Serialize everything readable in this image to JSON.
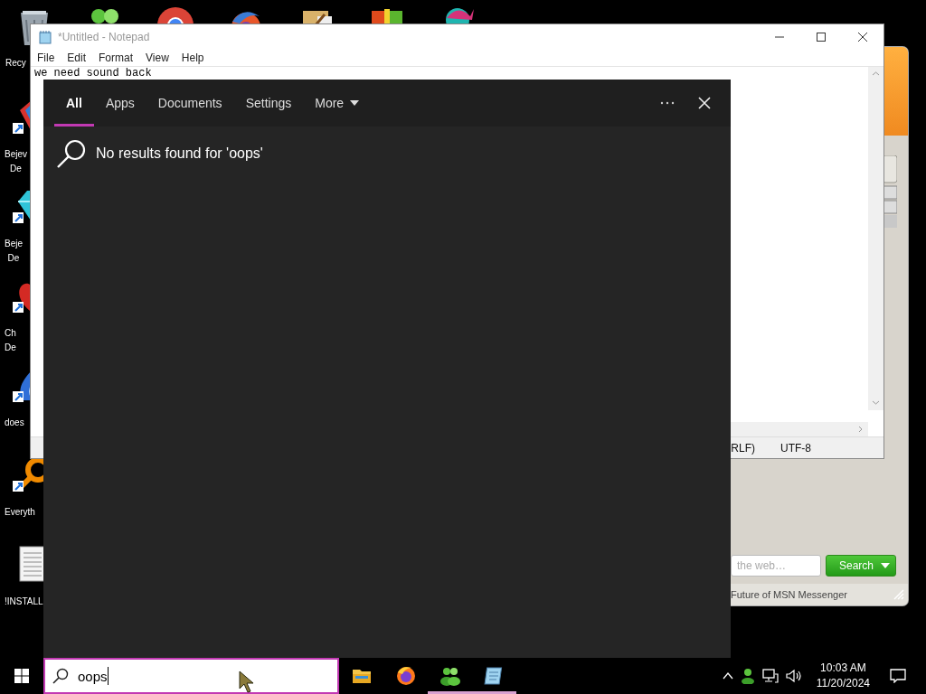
{
  "desktop": {
    "top_icons": [
      {
        "kind": "recycle",
        "label": "Recy"
      },
      {
        "kind": "people"
      },
      {
        "kind": "ring"
      },
      {
        "kind": "swirl"
      },
      {
        "kind": "paint"
      },
      {
        "kind": "shield"
      },
      {
        "kind": "figure"
      }
    ],
    "side_icons": [
      {
        "kind": "gem",
        "label_lines": [
          "Bejev",
          "De"
        ]
      },
      {
        "kind": "diamond",
        "label_lines": [
          "Beje",
          "De"
        ]
      },
      {
        "kind": "heart",
        "label_lines": [
          "Ch",
          "De"
        ]
      },
      {
        "kind": "flame",
        "label_lines": [
          "does"
        ]
      },
      {
        "kind": "magnifier",
        "label_lines": [
          "Everyth"
        ]
      },
      {
        "kind": "document",
        "label_lines": [
          "!INSTALL"
        ]
      }
    ]
  },
  "notepad": {
    "title": "*Untitled - Notepad",
    "menu": [
      "File",
      "Edit",
      "Format",
      "View",
      "Help"
    ],
    "text": "we need sound back",
    "status": [
      "RLF)",
      "UTF-8"
    ]
  },
  "messenger": {
    "search_placeholder": "the web…",
    "search_button": "Search",
    "footer": "Future of MSN Messenger"
  },
  "search_panel": {
    "tabs": [
      {
        "label": "All",
        "selected": true
      },
      {
        "label": "Apps",
        "selected": false
      },
      {
        "label": "Documents",
        "selected": false
      },
      {
        "label": "Settings",
        "selected": false
      },
      {
        "label": "More",
        "selected": false,
        "kind": "dropdown"
      }
    ],
    "message": "No results found for 'oops'"
  },
  "taskbar": {
    "search_value": "oops",
    "apps": [
      {
        "kind": "folder",
        "running": false
      },
      {
        "kind": "browser",
        "running": false
      },
      {
        "kind": "people",
        "running": true
      },
      {
        "kind": "notepad",
        "running": true
      }
    ],
    "clock": {
      "time": "10:03 AM",
      "date": "11/20/2024"
    }
  }
}
